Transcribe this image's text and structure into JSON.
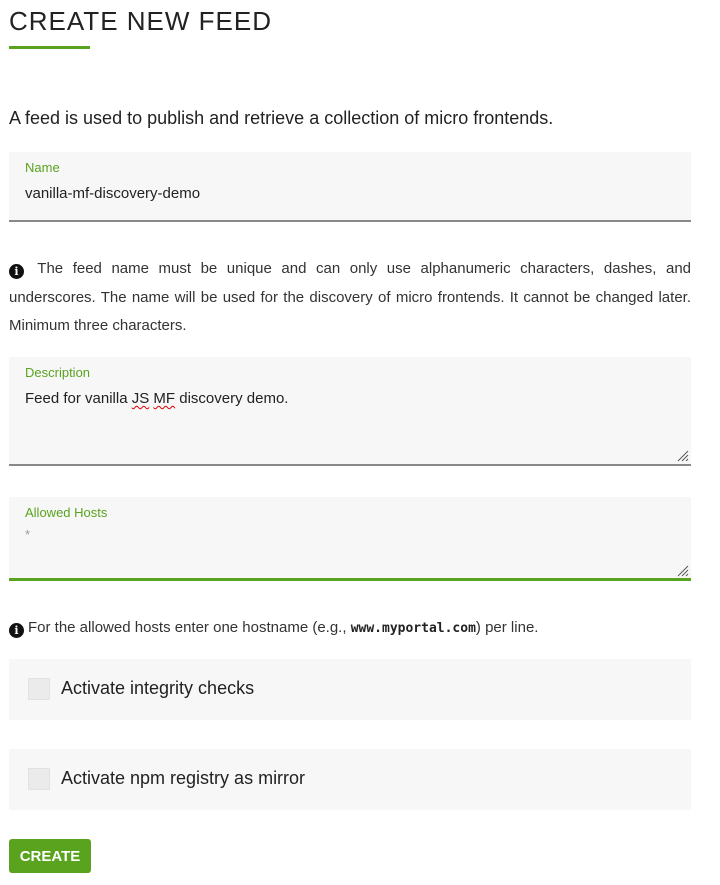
{
  "page": {
    "title": "CREATE NEW FEED",
    "intro": "A feed is used to publish and retrieve a collection of micro frontends."
  },
  "form": {
    "name": {
      "label": "Name",
      "value": "vanilla-mf-discovery-demo"
    },
    "name_hint": "The feed name must be unique and can only use alphanumeric characters, dashes, and underscores. The name will be used for the discovery of micro frontends. It cannot be changed later. Minimum three characters.",
    "description": {
      "label": "Description",
      "value_before": "Feed for vanilla ",
      "value_js": "JS",
      "value_space": " ",
      "value_mf": "MF",
      "value_after": " discovery demo."
    },
    "allowed_hosts": {
      "label": "Allowed Hosts",
      "placeholder": "*"
    },
    "hosts_hint": {
      "before": "For the allowed hosts enter one hostname (e.g., ",
      "example": "www.myportal.com",
      "after": ") per line."
    },
    "integrity_checks": {
      "label": "Activate integrity checks",
      "checked": false
    },
    "npm_mirror": {
      "label": "Activate npm registry as mirror",
      "checked": false
    },
    "submit_label": "CREATE"
  },
  "colors": {
    "accent": "#5aa31f",
    "field_bg": "#f7f7f7"
  },
  "icons": {
    "info": "info-circle-icon",
    "resize": "resize-grip-icon"
  }
}
